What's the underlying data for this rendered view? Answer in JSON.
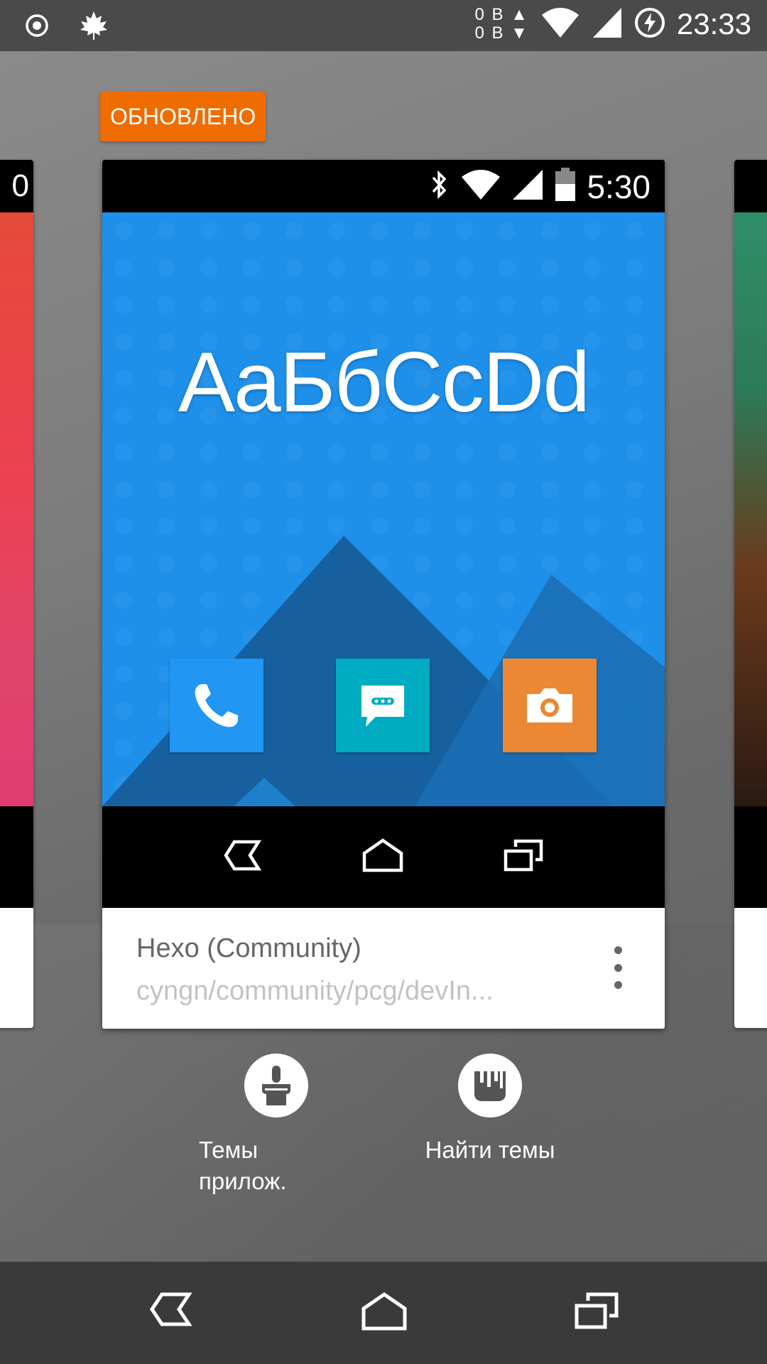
{
  "status_bar": {
    "traffic_up": "0 B",
    "traffic_down": "0 B",
    "time": "23:33",
    "left_icons": [
      "target-icon",
      "maple-leaf-icon"
    ],
    "right_icons": [
      "wifi-icon",
      "signal-icon",
      "battery-charging-icon"
    ]
  },
  "badge": {
    "label": "ОБНОВЛЕНО",
    "color": "#ef6c00"
  },
  "left_card": {
    "status_text": "0"
  },
  "theme_card": {
    "preview_status": {
      "time": "5:30",
      "icons": [
        "bluetooth-icon",
        "wifi-icon",
        "signal-icon",
        "battery-icon"
      ]
    },
    "font_sample": "AaБбCcDd",
    "screen_color": "#1e90ea",
    "apps": [
      {
        "name": "phone-app-icon",
        "color": "#2196f3"
      },
      {
        "name": "messages-app-icon",
        "color": "#00acc1"
      },
      {
        "name": "camera-app-icon",
        "color": "#ec8734"
      }
    ],
    "name": "Hexo (Community)",
    "source": "cyngn/community/pcg/devIn..."
  },
  "actions": [
    {
      "label": "Темы прилож.",
      "icon": "paintbrush-icon"
    },
    {
      "label": "Найти темы",
      "icon": "paint-bucket-icon"
    }
  ],
  "navbar": {
    "buttons": [
      "back-icon",
      "home-icon",
      "recents-icon"
    ]
  }
}
